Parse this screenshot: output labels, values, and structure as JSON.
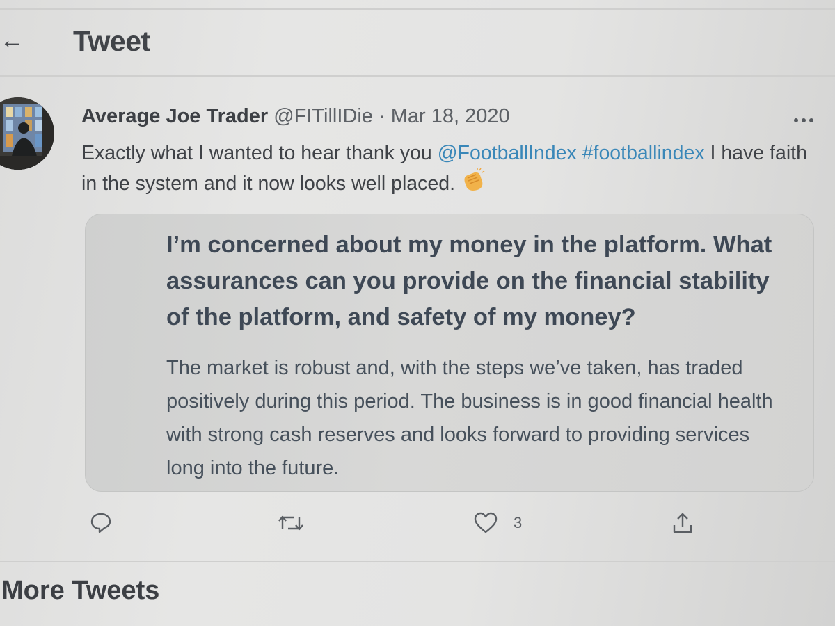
{
  "header": {
    "back_icon": "back-arrow-icon",
    "title": "Tweet"
  },
  "tweet": {
    "author_name": "Average Joe Trader",
    "handle": "@FITillIDie",
    "separator": "·",
    "date": "Mar 18, 2020",
    "text_part1": "Exactly what I wanted to hear thank you ",
    "mention": "@FootballIndex",
    "hashtag": "#footballindex",
    "text_part2": " I have faith in the system and it now looks well placed. ",
    "emoji": "clapping-hands-icon",
    "quote": {
      "heading": "I’m concerned about my money in the platform. What assurances can you provide on the financial stability of the platform, and safety of my money?",
      "body": "The market is robust and, with the steps we’ve taken, has traded positively during this period. The business is in good financial health with strong cash reserves and looks forward to providing services long into the future."
    },
    "actions": {
      "reply_icon": "reply-icon",
      "retweet_icon": "retweet-icon",
      "like_icon": "heart-icon",
      "like_count": "3",
      "share_icon": "share-icon"
    }
  },
  "more_tweets_heading": "More Tweets",
  "colors": {
    "link": "#3a87b8",
    "background": "#e2e2e1",
    "card": "#d4d4d3"
  }
}
